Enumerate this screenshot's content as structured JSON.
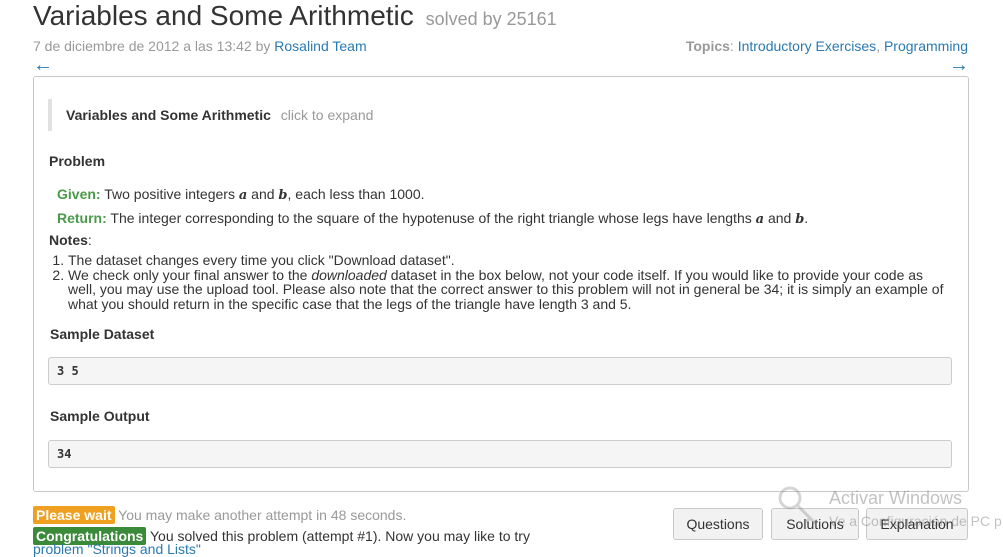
{
  "header": {
    "title": "Variables and Some Arithmetic",
    "solved_by": "solved by 25161",
    "date": "7 de diciembre de 2012 a las 13:42 by",
    "author": "Rosalind Team",
    "topics_label": "Topics",
    "topics_sep": ":",
    "topic_1": "Introductory Exercises",
    "topic_comma": ",",
    "topic_2": "Programming",
    "prev_arrow": "←",
    "next_arrow": "→"
  },
  "expander": {
    "title": "Variables and Some Arithmetic",
    "hint": "click to expand"
  },
  "problem": {
    "heading": "Problem",
    "given_label": "Given:",
    "given_text_1": "Two positive integers",
    "var_a": "a",
    "and": "and",
    "var_b": "b",
    "given_text_2": ", each less than 1000.",
    "return_label": "Return:",
    "return_text": "The integer corresponding to the square of the hypotenuse of the right triangle whose legs have lengths",
    "return_end": "."
  },
  "notes": {
    "heading": "Notes",
    "colon": ":",
    "item_1": "The dataset changes every time you click \"Download dataset\".",
    "item_2_pre": "We check only your final answer to the",
    "item_2_em": "downloaded",
    "item_2_post": "dataset in the box below, not your code itself. If you would like to provide your code as well, you may use the upload tool. Please also note that the correct answer to this problem will not in general be 34; it is simply an example of what you should return in the specific case that the legs of the triangle have length 3 and 5."
  },
  "sample_dataset": {
    "heading": "Sample Dataset",
    "value": "3 5"
  },
  "sample_output": {
    "heading": "Sample Output",
    "value": "34"
  },
  "status": {
    "wait_badge": "Please wait",
    "wait_text": "You may make another attempt in 48 seconds.",
    "congrats_badge": "Congratulations",
    "congrats_text": "You solved this problem (attempt #1). Now you may like to try",
    "next_problem": "problem \"Strings and Lists\""
  },
  "buttons": {
    "questions": "Questions",
    "solutions": "Solutions",
    "explanation": "Explanation"
  },
  "watermark": {
    "line1": "Activar Windows",
    "line2": "Ve a Configuración de PC p"
  },
  "colors": {
    "link": "#2a7ab0",
    "given_green": "#4a9a4a",
    "wait_orange": "#f0a020",
    "congrats_green": "#3a8a3a"
  }
}
